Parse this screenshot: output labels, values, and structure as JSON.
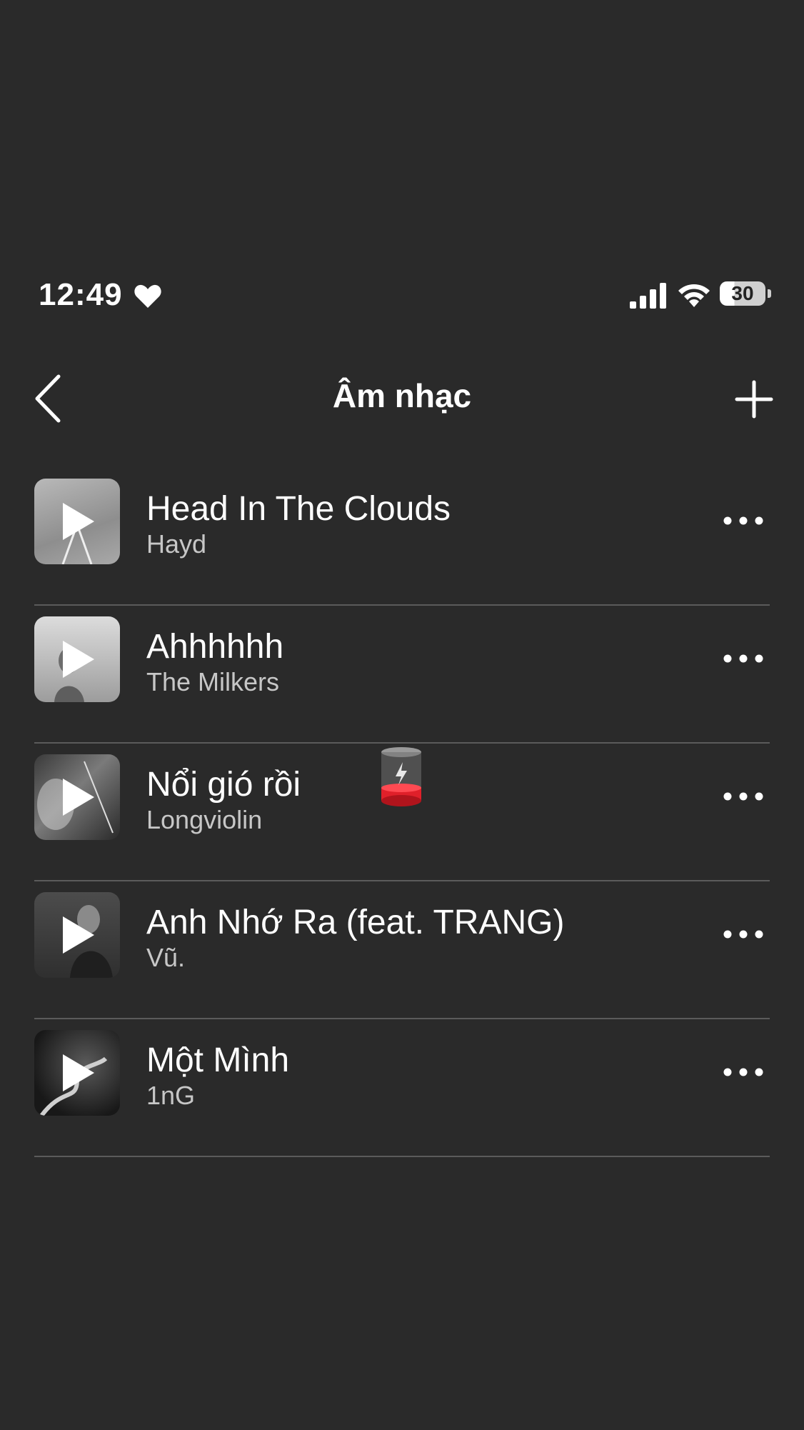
{
  "status_bar": {
    "time": "12:49",
    "battery_level": "30",
    "icons": [
      "heart-icon",
      "cellular-signal-icon",
      "wifi-icon",
      "battery-icon"
    ]
  },
  "nav": {
    "title": "Âm nhạc",
    "back_icon": "chevron-left-icon",
    "add_icon": "plus-icon"
  },
  "songs": [
    {
      "title": "Head In The Clouds",
      "artist": "Hayd"
    },
    {
      "title": "Ahhhhhh",
      "artist": "The Milkers"
    },
    {
      "title": "Nổi gió rồi",
      "artist": "Longviolin"
    },
    {
      "title": "Anh Nhớ Ra (feat. TRANG)",
      "artist": "Vũ."
    },
    {
      "title": "Một Mình",
      "artist": "1nG"
    }
  ],
  "colors": {
    "background": "#2a2a2a",
    "text": "#ffffff",
    "secondary_text": "#c7c7c7",
    "divider": "#5b5b5b",
    "battery_widget_red": "#e0202a"
  }
}
